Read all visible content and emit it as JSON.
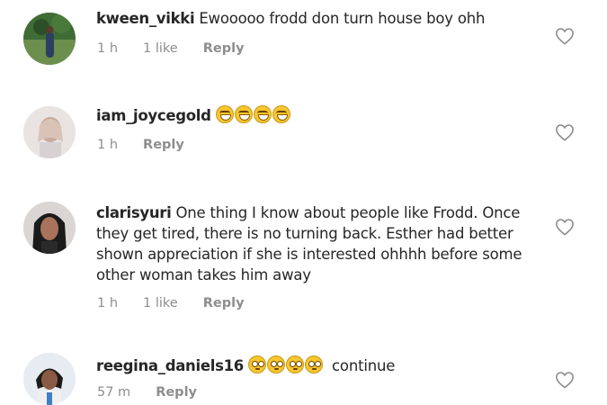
{
  "comments": [
    {
      "username": "kween_vikki",
      "text": "Ewooooo frodd don turn house boy ohh",
      "time": "1 h",
      "likes": "1 like",
      "reply": "Reply",
      "avatar_icon": "avatar-photo-icon"
    },
    {
      "username": "iam_joycegold",
      "text": "",
      "emojis": [
        "grinning-squint-face",
        "grinning-squint-face",
        "grinning-squint-face",
        "grinning-squint-face"
      ],
      "time": "1 h",
      "reply": "Reply",
      "avatar_icon": "avatar-photo-icon"
    },
    {
      "username": "clarisyuri",
      "text": "One thing I know about people like Frodd. Once they get tired, there is no turning back. Esther had better shown appreciation if she is interested ohhhh before some other woman takes him away",
      "time": "1 h",
      "likes": "1 like",
      "reply": "Reply",
      "avatar_icon": "avatar-photo-icon"
    },
    {
      "username": "reegina_daniels16",
      "emojis": [
        "flushed-face",
        "flushed-face",
        "flushed-face",
        "flushed-face"
      ],
      "text_after": "continue",
      "time": "57 m",
      "reply": "Reply",
      "avatar_icon": "avatar-photo-icon"
    }
  ],
  "icons": {
    "like": "heart-outline-icon"
  },
  "colors": {
    "text": "#262626",
    "meta": "#8e8e8e",
    "background": "#ffffff"
  }
}
